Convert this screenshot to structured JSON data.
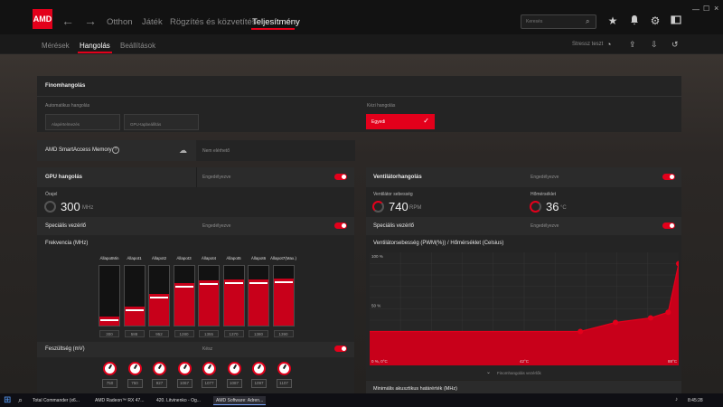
{
  "nav": {
    "logo": "AMD",
    "back": "←",
    "forward": "→",
    "tabs": [
      "Otthon",
      "Játék",
      "Rögzítés és közvetítés",
      "Teljesítmény"
    ],
    "active_tab": "Teljesítmény",
    "search_placeholder": "Keresés"
  },
  "subnav": {
    "tabs": [
      "Mérések",
      "Hangolás",
      "Beállítások"
    ],
    "active_tab": "Hangolás",
    "stress_test": "Stressz teszt"
  },
  "finomhangolas": {
    "title": "Finomhangolás",
    "auto_label": "Automatikus hangolás",
    "auto_options": [
      "Alapértelmezés",
      "GPU-tapbeállítás"
    ],
    "manual_label": "Kézi hangolás",
    "manual_value": "Egyedi"
  },
  "smart_access": {
    "label": "AMD SmartAccess Memory",
    "status": "Nem elérhető"
  },
  "gpu": {
    "title": "GPU hangolás",
    "status": "Engedélyezve",
    "clock_label": "Órajel",
    "clock_value": "300",
    "clock_unit": "MHz",
    "special_label": "Speciális vezérlő",
    "special_status": "Engedélyezve",
    "freq_label": "Frekvencia (MHz)",
    "states": [
      {
        "label": "ÁllapotMin",
        "value": 300,
        "display": "300"
      },
      {
        "label": "Állapot1",
        "value": 588,
        "display": "588"
      },
      {
        "label": "Állapot2",
        "value": 952,
        "display": "952"
      },
      {
        "label": "Állapot3",
        "value": 1280,
        "display": "1280"
      },
      {
        "label": "Állapot4",
        "value": 1355,
        "display": "1355"
      },
      {
        "label": "Állapot5",
        "value": 1370,
        "display": "1370"
      },
      {
        "label": "Állapot6",
        "value": 1380,
        "display": "1380"
      },
      {
        "label": "Állapot7(Max.)",
        "value": 1390,
        "display": "1390"
      }
    ],
    "voltage_label": "Feszültség (mV)",
    "voltage_status": "Kész",
    "voltages": [
      "750",
      "750",
      "927",
      "1067",
      "1077",
      "1087",
      "1097",
      "1107"
    ]
  },
  "fan": {
    "title": "Ventilátorhangolás",
    "status": "Engedélyezve",
    "speed_label": "Ventilátor sebesség",
    "speed_value": "740",
    "speed_unit": "RPM",
    "temp_label": "Hőmérséklet",
    "temp_value": "36",
    "temp_unit": "°C",
    "special_label": "Speciális vezérlő",
    "special_status": "Engedélyezve",
    "chart_title": "Ventilátorsebesség (PWM(%)) / Hőmérséklet (Celsius)",
    "finetune_label": "Finomhangolás vezérlők",
    "min_acoustic_label": "Minimális akusztikus határérték (MHz)"
  },
  "chart_data": {
    "type": "area",
    "x_tick_labels": [
      "0 %, 0°C",
      "42°C",
      "88°C"
    ],
    "y_tick_labels": [
      "100 %",
      "50 %"
    ],
    "xlim": [
      0,
      88
    ],
    "ylim": [
      0,
      100
    ],
    "x": [
      0,
      60,
      70,
      80,
      85,
      88
    ],
    "values": [
      30,
      30,
      38,
      42,
      47,
      90
    ],
    "series": [
      {
        "values": [
          30,
          30,
          38,
          42,
          47,
          90
        ]
      }
    ],
    "color": "#c8001a"
  },
  "taskbar": {
    "items": [
      "Total Commander (x6...",
      "AMD Radeon™ RX 47...",
      "420. Litvinenko - Og...",
      "AMD Software: Adren..."
    ],
    "clock": "8:45:28"
  },
  "colors": {
    "accent": "#e3001b",
    "bg": "#1b1b1b"
  }
}
